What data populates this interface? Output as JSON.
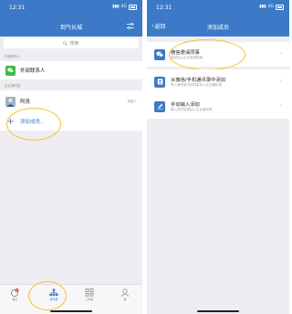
{
  "left": {
    "status": {
      "time": "12:31",
      "network": "4G"
    },
    "nav": {
      "title": "到气长城"
    },
    "search": {
      "placeholder": "搜索",
      "icon": "search-icon"
    },
    "external_section": {
      "label": "外部联系人",
      "item": {
        "label": "外部联系人",
        "icon": "wechat-contacts-icon",
        "icon_color": "#3fba47"
      }
    },
    "company_section": {
      "label": "企业通讯录",
      "members": [
        {
          "name": "阿良",
          "tag": "创建人"
        }
      ],
      "add_member": {
        "label": "添加成员...",
        "icon": "plus-icon"
      }
    },
    "tabbar": [
      {
        "label": "消息",
        "icon": "message-icon",
        "badge": "1",
        "active": false
      },
      {
        "label": "通讯录",
        "icon": "contacts-tree-icon",
        "active": true
      },
      {
        "label": "工作台",
        "icon": "workbench-grid-icon",
        "active": false
      },
      {
        "label": "我",
        "icon": "profile-icon",
        "active": false
      }
    ]
  },
  "right": {
    "status": {
      "time": "12:31",
      "network": "4G"
    },
    "nav": {
      "title": "添加成员",
      "back_label": "返回"
    },
    "options": [
      {
        "title": "微信邀请同事",
        "desc": "发送加入企业邀请链接",
        "icon": "wechat-chat-icon"
      },
      {
        "title": "从微信/手机通讯录中添加",
        "desc": "导入通讯录中的同事加入企业通讯录",
        "icon": "address-book-icon"
      },
      {
        "title": "手动输入添加",
        "desc": "输入成员信息加入企业通讯录",
        "icon": "pencil-edit-icon"
      }
    ]
  },
  "colors": {
    "nav_blue": "#3c7ac8",
    "highlight": "#f2c22b",
    "badge_red": "#e64340"
  }
}
